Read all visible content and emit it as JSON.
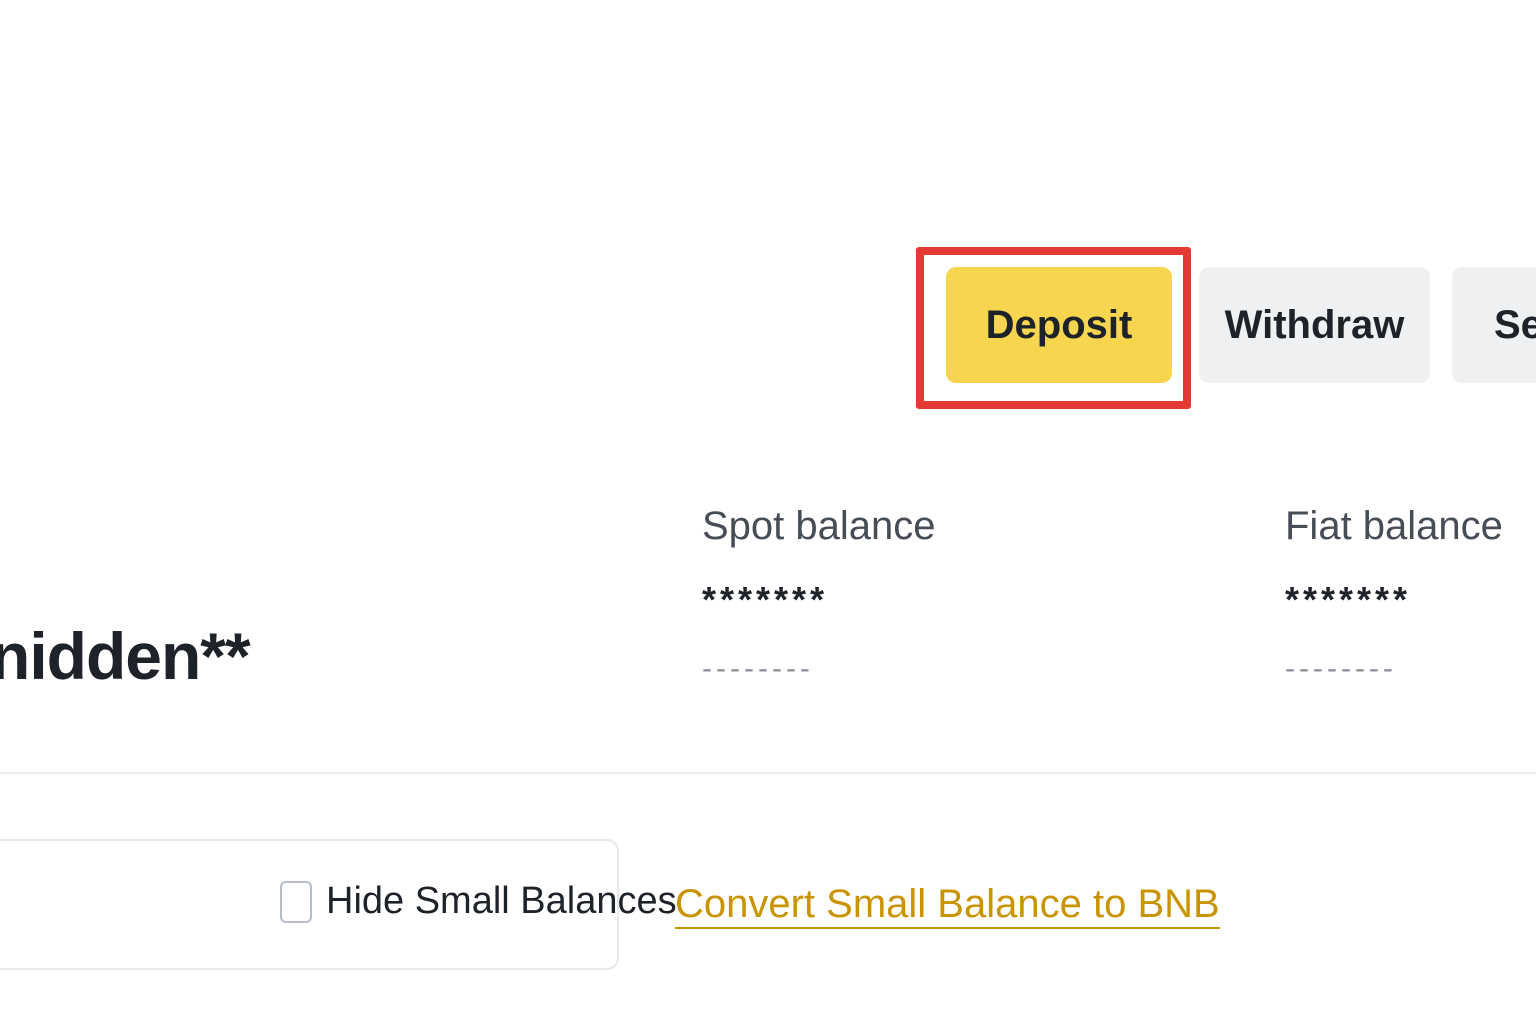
{
  "actions": {
    "deposit_label": "Deposit",
    "withdraw_label": "Withdraw",
    "send_label": "Se"
  },
  "balance": {
    "total_value": "nidden**",
    "spot": {
      "label": "Spot balance",
      "value": "*******",
      "sub_value": "--------"
    },
    "fiat": {
      "label": "Fiat balance",
      "value": "*******",
      "sub_value": "--------"
    }
  },
  "filters": {
    "hide_small_label": "Hide Small Balances",
    "hide_small_checked": false,
    "convert_link_label": "Convert Small Balance to BNB"
  },
  "colors": {
    "highlight": "#e53935",
    "primary_button": "#f7d54e",
    "secondary_button": "#eff0f2",
    "link": "#c99400"
  }
}
